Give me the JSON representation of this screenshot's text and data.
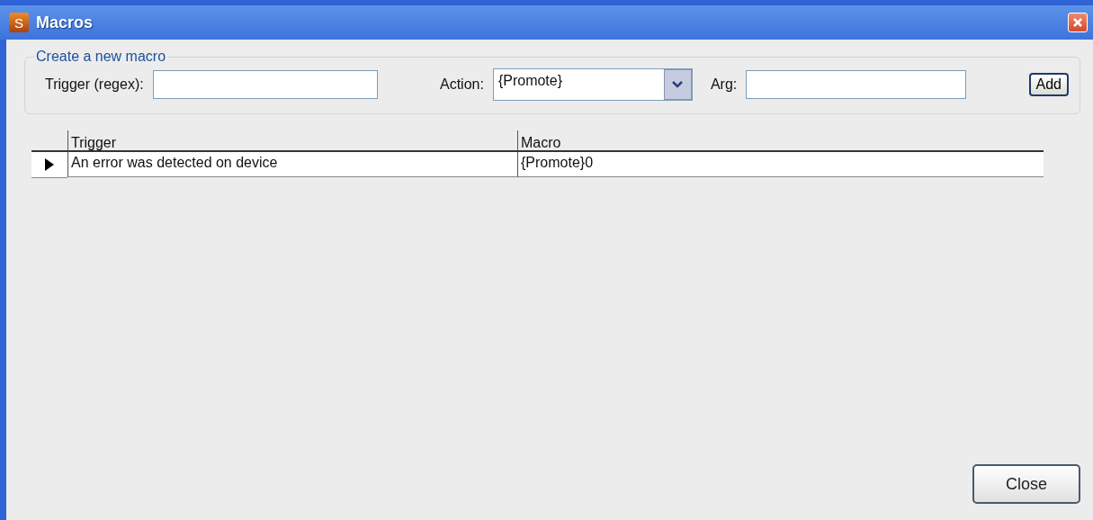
{
  "window": {
    "title": "Macros",
    "app_icon_letter": "S"
  },
  "new_macro": {
    "legend": "Create a new macro",
    "trigger_label": "Trigger (regex):",
    "action_label": "Action:",
    "action_value": "{Promote}",
    "arg_label": "Arg:",
    "add_button": "Add"
  },
  "table": {
    "columns": [
      "Trigger",
      "Macro"
    ],
    "rows": [
      {
        "selected": true,
        "cells": [
          "An error was detected on device",
          "{Promote}0"
        ]
      }
    ]
  },
  "close_button": "Close"
}
